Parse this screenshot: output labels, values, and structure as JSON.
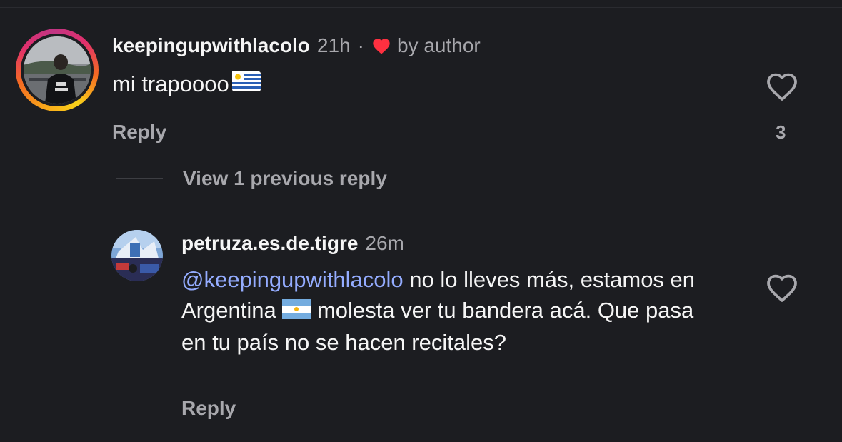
{
  "comments": [
    {
      "username": "keepingupwithlacolo",
      "time": "21h",
      "separator": "·",
      "liked_by_author": "by author",
      "text": "mi trapoooo",
      "reply_label": "Reply",
      "likes": "3"
    },
    {
      "username": "petruza.es.de.tigre",
      "time": "26m",
      "mention": "@keepingupwithlacolo",
      "text_part1": " no lo lleves más, estamos en Argentina ",
      "text_part2": " molesta ver tu bandera acá. Que pasa en tu país no se hacen recitales?",
      "reply_label": "Reply"
    }
  ],
  "thread": {
    "view_previous": "View 1 previous reply"
  },
  "icons": {
    "heart_filled": "heart-filled-icon",
    "heart_outline": "heart-outline-icon",
    "flag_uruguay": "uruguay-flag-icon",
    "flag_argentina": "argentina-flag-icon"
  },
  "colors": {
    "background": "#1c1d21",
    "text": "#f5f5f5",
    "secondary": "#a8a8ad",
    "mention": "#94acff",
    "heart_red": "#ff3040"
  }
}
